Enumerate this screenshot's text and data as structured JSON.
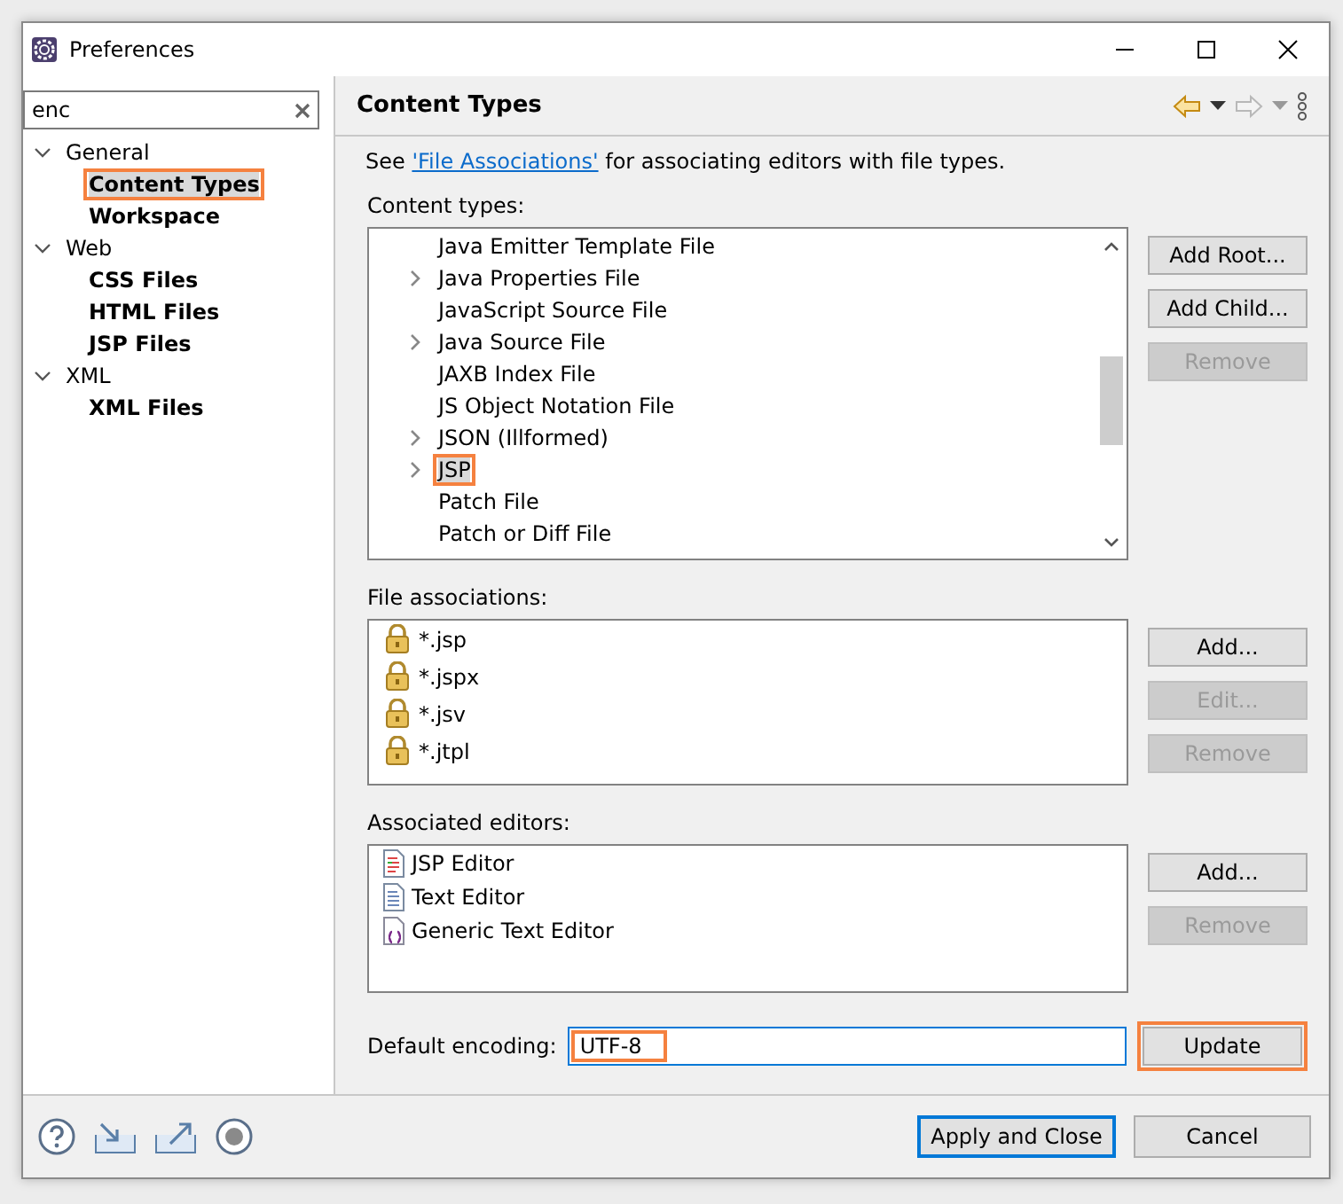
{
  "window": {
    "title": "Preferences"
  },
  "filter": {
    "value": "enc"
  },
  "sidebar": {
    "items": [
      {
        "label": "General",
        "expanded": true,
        "children": [
          {
            "label": "Content Types",
            "selected": true,
            "highlighted": true
          },
          {
            "label": "Workspace",
            "selected": false,
            "highlighted": false
          }
        ]
      },
      {
        "label": "Web",
        "expanded": true,
        "children": [
          {
            "label": "CSS Files",
            "selected": false,
            "highlighted": false
          },
          {
            "label": "HTML Files",
            "selected": false,
            "highlighted": false
          },
          {
            "label": "JSP Files",
            "selected": false,
            "highlighted": false
          }
        ]
      },
      {
        "label": "XML",
        "expanded": true,
        "children": [
          {
            "label": "XML Files",
            "selected": false,
            "highlighted": false
          }
        ]
      }
    ]
  },
  "page": {
    "title": "Content Types",
    "description_before": "See ",
    "link": "'File Associations'",
    "description_after": " for associating editors with file types."
  },
  "content_types": {
    "label": "Content types:",
    "items": [
      {
        "label": "Java Emitter Template File",
        "expandable": false,
        "selected": false,
        "highlighted": false
      },
      {
        "label": "Java Properties File",
        "expandable": true,
        "selected": false,
        "highlighted": false
      },
      {
        "label": "JavaScript Source File",
        "expandable": false,
        "selected": false,
        "highlighted": false
      },
      {
        "label": "Java Source File",
        "expandable": true,
        "selected": false,
        "highlighted": false
      },
      {
        "label": "JAXB Index File",
        "expandable": false,
        "selected": false,
        "highlighted": false
      },
      {
        "label": "JS Object Notation File",
        "expandable": false,
        "selected": false,
        "highlighted": false
      },
      {
        "label": "JSON (Illformed)",
        "expandable": true,
        "selected": false,
        "highlighted": false
      },
      {
        "label": "JSP",
        "expandable": true,
        "selected": true,
        "highlighted": true
      },
      {
        "label": "Patch File",
        "expandable": false,
        "selected": false,
        "highlighted": false
      },
      {
        "label": "Patch or Diff File",
        "expandable": false,
        "selected": false,
        "highlighted": false
      }
    ],
    "buttons": [
      {
        "label": "Add Root...",
        "disabled": false
      },
      {
        "label": "Add Child...",
        "disabled": false
      },
      {
        "label": "Remove",
        "disabled": true
      }
    ]
  },
  "file_associations": {
    "label": "File associations:",
    "items": [
      {
        "label": "*.jsp"
      },
      {
        "label": "*.jspx"
      },
      {
        "label": "*.jsv"
      },
      {
        "label": "*.jtpl"
      }
    ],
    "buttons": [
      {
        "label": "Add...",
        "disabled": false
      },
      {
        "label": "Edit...",
        "disabled": true
      },
      {
        "label": "Remove",
        "disabled": true
      }
    ]
  },
  "associated_editors": {
    "label": "Associated editors:",
    "items": [
      {
        "label": "JSP Editor",
        "kind": "jsp"
      },
      {
        "label": "Text Editor",
        "kind": "text"
      },
      {
        "label": "Generic Text Editor",
        "kind": "generic"
      }
    ],
    "buttons": [
      {
        "label": "Add...",
        "disabled": false
      },
      {
        "label": "Remove",
        "disabled": true
      }
    ]
  },
  "encoding": {
    "label": "Default encoding:",
    "value": "UTF-8",
    "highlighted": true,
    "button": {
      "label": "Update",
      "highlighted": true
    }
  },
  "footer": {
    "buttons": [
      {
        "label": "Apply and Close",
        "default": true
      },
      {
        "label": "Cancel",
        "default": false
      }
    ]
  }
}
